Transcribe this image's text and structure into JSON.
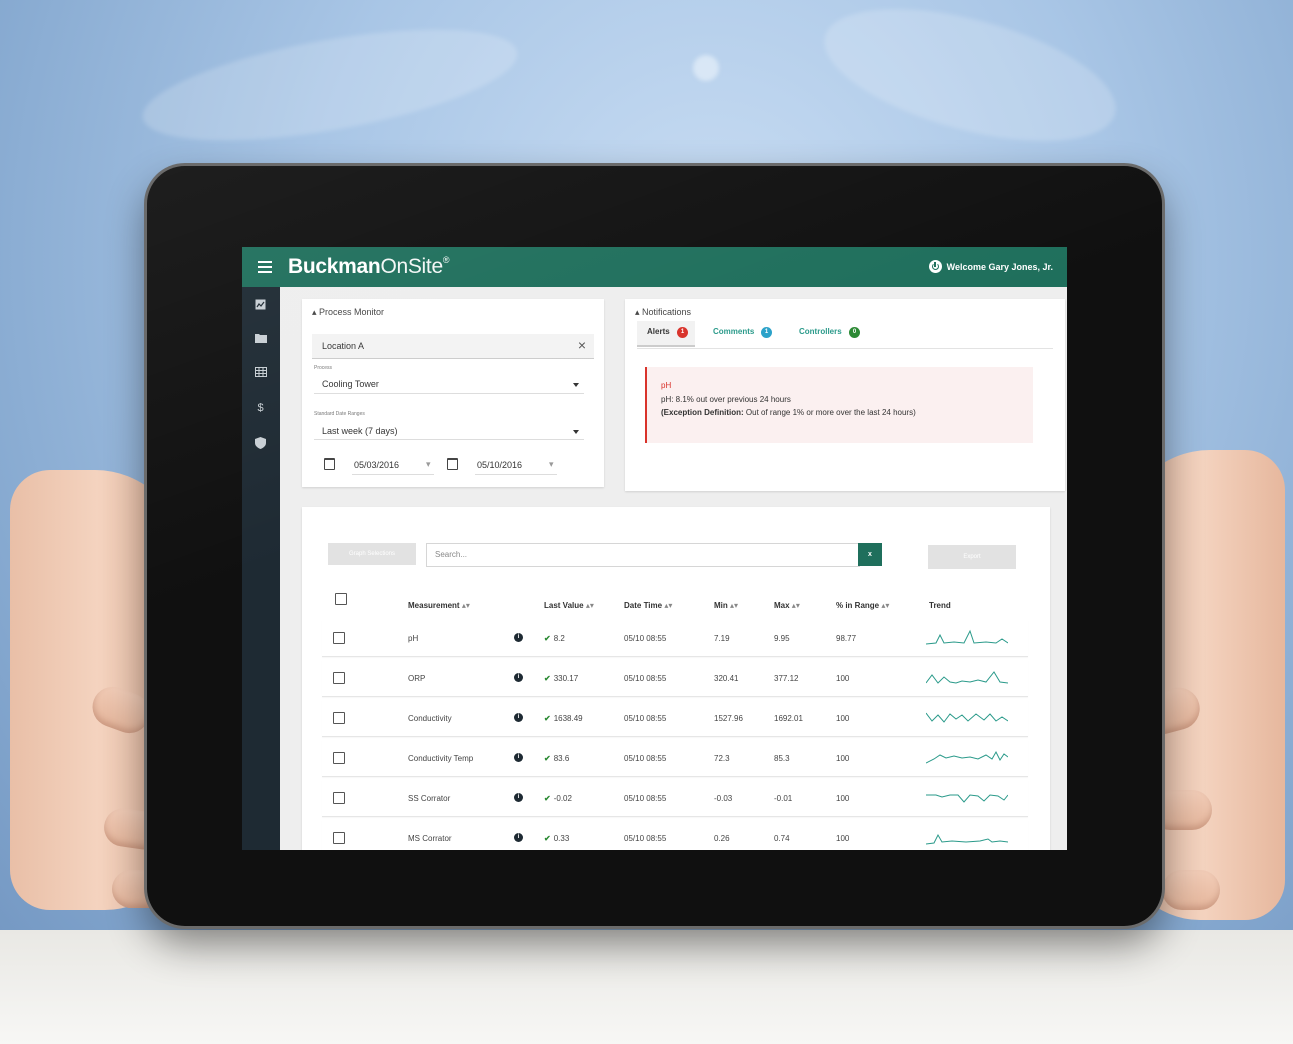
{
  "app": {
    "brand_bold": "Buckman",
    "brand_light": "OnSite",
    "brand_mark": "®",
    "welcome": "Welcome Gary Jones, Jr."
  },
  "sidenav": {
    "icons": [
      "dashboard-icon",
      "folder-icon",
      "grid-icon",
      "dollar-icon",
      "shield-icon"
    ],
    "dollar_glyph": "$"
  },
  "process_monitor": {
    "title": "Process Monitor",
    "location_value": "Location A",
    "location_clear": "×",
    "process_label": "Process",
    "process_value": "Cooling Tower",
    "date_range_label": "Standard Date Ranges",
    "date_range_value": "Last week (7 days)",
    "start_date": "05/03/2016",
    "end_date": "05/10/2016"
  },
  "notifications": {
    "title": "Notifications",
    "tabs": [
      {
        "label": "Alerts",
        "count": "1",
        "color": "#d9322a"
      },
      {
        "label": "Comments",
        "count": "1",
        "color": "#2aa1c9"
      },
      {
        "label": "Controllers",
        "count": "0",
        "color": "#2c8a34"
      }
    ],
    "alert": {
      "heading": "pH",
      "message": "pH: 8.1% out over previous 24 hours",
      "definition_label": "(Exception Definition:",
      "definition_text": " Out of range 1% or more over the last 24 hours)"
    }
  },
  "table_tools": {
    "graph_button": "Graph Selections",
    "search_placeholder": "Search...",
    "clear_button": "x",
    "export_button": "Export"
  },
  "table": {
    "headers": {
      "measurement": "Measurement",
      "last_value": "Last Value",
      "date_time": "Date Time",
      "min": "Min",
      "max": "Max",
      "in_range": "% in Range",
      "trend": "Trend",
      "sort_glyph": "▴▾"
    },
    "info_glyph": "i",
    "check_glyph": "✔",
    "rows": [
      {
        "measurement": "pH",
        "last_value": "8.2",
        "date_time": "05/10 08:55",
        "min": "7.19",
        "max": "9.95",
        "in_range": "98.77"
      },
      {
        "measurement": "ORP",
        "last_value": "330.17",
        "date_time": "05/10 08:55",
        "min": "320.41",
        "max": "377.12",
        "in_range": "100"
      },
      {
        "measurement": "Conductivity",
        "last_value": "1638.49",
        "date_time": "05/10 08:55",
        "min": "1527.96",
        "max": "1692.01",
        "in_range": "100"
      },
      {
        "measurement": "Conductivity Temp",
        "last_value": "83.6",
        "date_time": "05/10 08:55",
        "min": "72.3",
        "max": "85.3",
        "in_range": "100"
      },
      {
        "measurement": "SS Corrator",
        "last_value": "-0.02",
        "date_time": "05/10 08:55",
        "min": "-0.03",
        "max": "-0.01",
        "in_range": "100"
      },
      {
        "measurement": "MS Corrator",
        "last_value": "0.33",
        "date_time": "05/10 08:55",
        "min": "0.26",
        "max": "0.74",
        "in_range": "100"
      }
    ]
  },
  "colors": {
    "brand_green": "#1f6f5c",
    "sidenav": "#1e2a33",
    "trend_line": "#2a9a8a",
    "alert_red": "#d9322a"
  }
}
